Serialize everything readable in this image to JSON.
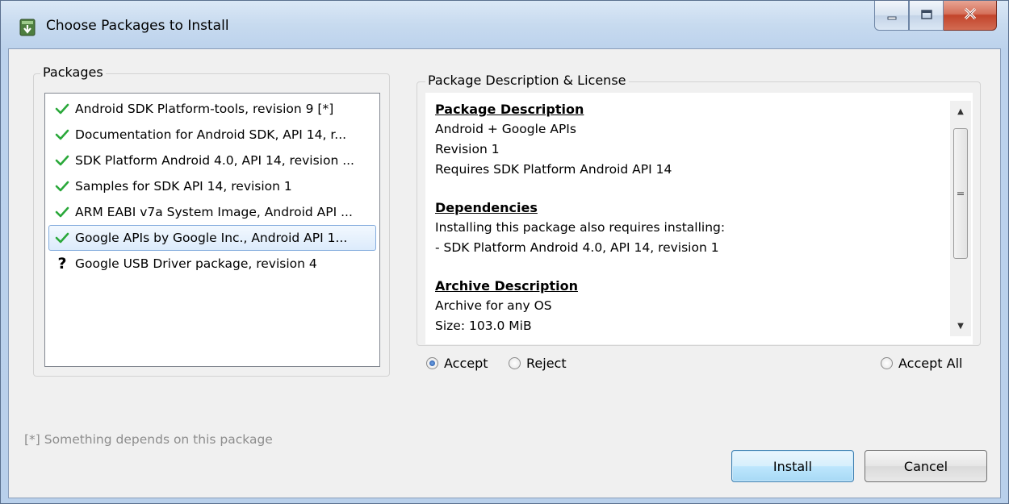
{
  "window": {
    "title": "Choose Packages to Install"
  },
  "packages_group": {
    "label": "Packages",
    "items": [
      {
        "status_icon": "checkmark-icon",
        "label": "Android SDK Platform-tools, revision 9 [*]",
        "selected": false
      },
      {
        "status_icon": "checkmark-icon",
        "label": "Documentation for Android SDK, API 14, r...",
        "selected": false
      },
      {
        "status_icon": "checkmark-icon",
        "label": "SDK Platform Android 4.0, API 14, revision ...",
        "selected": false
      },
      {
        "status_icon": "checkmark-icon",
        "label": "Samples for SDK API 14, revision 1",
        "selected": false
      },
      {
        "status_icon": "checkmark-icon",
        "label": "ARM EABI v7a System Image, Android API ...",
        "selected": false
      },
      {
        "status_icon": "checkmark-icon",
        "label": "Google APIs by Google Inc., Android API 1...",
        "selected": true
      },
      {
        "status_icon": "question-icon",
        "question_glyph": "?",
        "label": "Google USB Driver package, revision 4",
        "selected": false
      }
    ]
  },
  "description_group": {
    "label": "Package Description & License",
    "sections": [
      {
        "heading": "Package Description",
        "lines": [
          "Android + Google APIs",
          "Revision 1",
          "Requires SDK Platform Android API 14"
        ]
      },
      {
        "heading": "Dependencies",
        "lines": [
          "Installing this package also requires installing:",
          "- SDK Platform Android 4.0, API 14, revision 1"
        ]
      },
      {
        "heading": "Archive Description",
        "lines": [
          "Archive for any OS",
          "Size: 103.0 MiB"
        ]
      }
    ]
  },
  "license_options": {
    "accept_label": "Accept",
    "reject_label": "Reject",
    "accept_all_label": "Accept All",
    "selected": "accept"
  },
  "footer": {
    "note": "[*] Something depends on this package",
    "install_label": "Install",
    "cancel_label": "Cancel"
  },
  "colors": {
    "check_green": "#2aa83a",
    "title_bg": "#c7daef",
    "selection_border": "#84acdd",
    "close_red": "#c2442b"
  }
}
